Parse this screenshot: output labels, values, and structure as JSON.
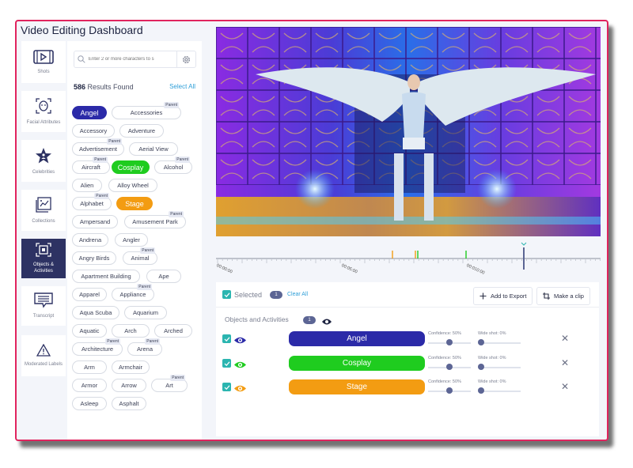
{
  "app": {
    "title": "Video Editing Dashboard"
  },
  "nav": {
    "items": [
      {
        "label": "Shots",
        "icon": "film-icon",
        "active": false
      },
      {
        "label": "Facial Attributes",
        "icon": "face-scan-icon",
        "active": false
      },
      {
        "label": "Celebrities",
        "icon": "star-person-icon",
        "active": false
      },
      {
        "label": "Collections",
        "icon": "collections-icon",
        "active": false
      },
      {
        "label": "Objects & Activities",
        "icon": "object-detect-icon",
        "active": true
      },
      {
        "label": "Transcript",
        "icon": "transcript-icon",
        "active": false
      },
      {
        "label": "Moderated Labels",
        "icon": "warning-icon",
        "active": false
      }
    ]
  },
  "filters": {
    "search_placeholder": "Enter 2 or more characters to s",
    "results_count": "586",
    "results_label": "Results Found",
    "select_all": "Select All",
    "parent_badge": "Parent",
    "tags": [
      {
        "label": "Angel",
        "selected": true,
        "color": "#2b2aa8",
        "parent": false
      },
      {
        "label": "Accessories",
        "selected": false,
        "parent": true
      },
      {
        "label": "Accessory",
        "selected": false,
        "parent": false
      },
      {
        "label": "Adventure",
        "selected": false,
        "parent": false
      },
      {
        "label": "Advertisement",
        "selected": false,
        "parent": true
      },
      {
        "label": "Aerial View",
        "selected": false,
        "parent": false
      },
      {
        "label": "Aircraft",
        "selected": false,
        "parent": true
      },
      {
        "label": "Cosplay",
        "selected": true,
        "color": "#1fcc1f",
        "parent": false
      },
      {
        "label": "Alcohol",
        "selected": false,
        "parent": true
      },
      {
        "label": "Alien",
        "selected": false,
        "parent": false
      },
      {
        "label": "Alloy Wheel",
        "selected": false,
        "parent": false
      },
      {
        "label": "Alphabet",
        "selected": false,
        "parent": true
      },
      {
        "label": "Stage",
        "selected": true,
        "color": "#f39c12",
        "parent": false
      },
      {
        "label": "Ampersand",
        "selected": false,
        "parent": false
      },
      {
        "label": "Amusement Park",
        "selected": false,
        "parent": true
      },
      {
        "label": "Andrena",
        "selected": false,
        "parent": false
      },
      {
        "label": "Angler",
        "selected": false,
        "parent": false
      },
      {
        "label": "Angry Birds",
        "selected": false,
        "parent": false
      },
      {
        "label": "Animal",
        "selected": false,
        "parent": true
      },
      {
        "label": "Apartment Building",
        "selected": false,
        "parent": false
      },
      {
        "label": "Ape",
        "selected": false,
        "parent": false
      },
      {
        "label": "Apparel",
        "selected": false,
        "parent": false
      },
      {
        "label": "Appliance",
        "selected": false,
        "parent": true
      },
      {
        "label": "Aqua Scuba",
        "selected": false,
        "parent": false
      },
      {
        "label": "Aquarium",
        "selected": false,
        "parent": false
      },
      {
        "label": "Aquatic",
        "selected": false,
        "parent": false
      },
      {
        "label": "Arch",
        "selected": false,
        "parent": false
      },
      {
        "label": "Arched",
        "selected": false,
        "parent": false
      },
      {
        "label": "Architecture",
        "selected": false,
        "parent": true
      },
      {
        "label": "Arena",
        "selected": false,
        "parent": true
      },
      {
        "label": "Arm",
        "selected": false,
        "parent": false
      },
      {
        "label": "Armchair",
        "selected": false,
        "parent": false
      },
      {
        "label": "Armor",
        "selected": false,
        "parent": false
      },
      {
        "label": "Arrow",
        "selected": false,
        "parent": false
      },
      {
        "label": "Art",
        "selected": false,
        "parent": true
      },
      {
        "label": "Asleep",
        "selected": false,
        "parent": false
      },
      {
        "label": "Asphalt",
        "selected": false,
        "parent": false
      }
    ]
  },
  "timeline": {
    "labels": [
      "00:00:00",
      "00:05:00",
      "00:010:00"
    ],
    "markers": [
      {
        "color": "#f39c12"
      },
      {
        "color": "#f39c12"
      },
      {
        "color": "#1fcc1f"
      },
      {
        "color": "#1fcc1f"
      }
    ],
    "playhead_color": "#5c6594"
  },
  "selection": {
    "selected_label": "Selected",
    "selected_count": "1",
    "clear_all": "Clear All",
    "add_to_export": "Add to Export",
    "make_clip": "Make a clip",
    "section_label": "Objects and Activities",
    "section_count": "1",
    "objects": [
      {
        "label": "Angel",
        "color": "#2b2aa8",
        "confidence_label": "Confidence: 50%",
        "confidence": 50,
        "wide_shot_label": "Wide shot: 0%",
        "wide_shot": 0,
        "checked": true
      },
      {
        "label": "Cosplay",
        "color": "#1fcc1f",
        "confidence_label": "Confidence: 50%",
        "confidence": 50,
        "wide_shot_label": "Wide shot: 0%",
        "wide_shot": 0,
        "checked": true
      },
      {
        "label": "Stage",
        "color": "#f39c12",
        "confidence_label": "Confidence: 50%",
        "confidence": 50,
        "wide_shot_label": "Wide shot: 0%",
        "wide_shot": 0,
        "checked": true
      }
    ]
  },
  "colors": {
    "accent": "#2f9fd8",
    "frame_border": "#e0245e",
    "nav_active": "#2d3263",
    "check": "#2bb5b0"
  }
}
